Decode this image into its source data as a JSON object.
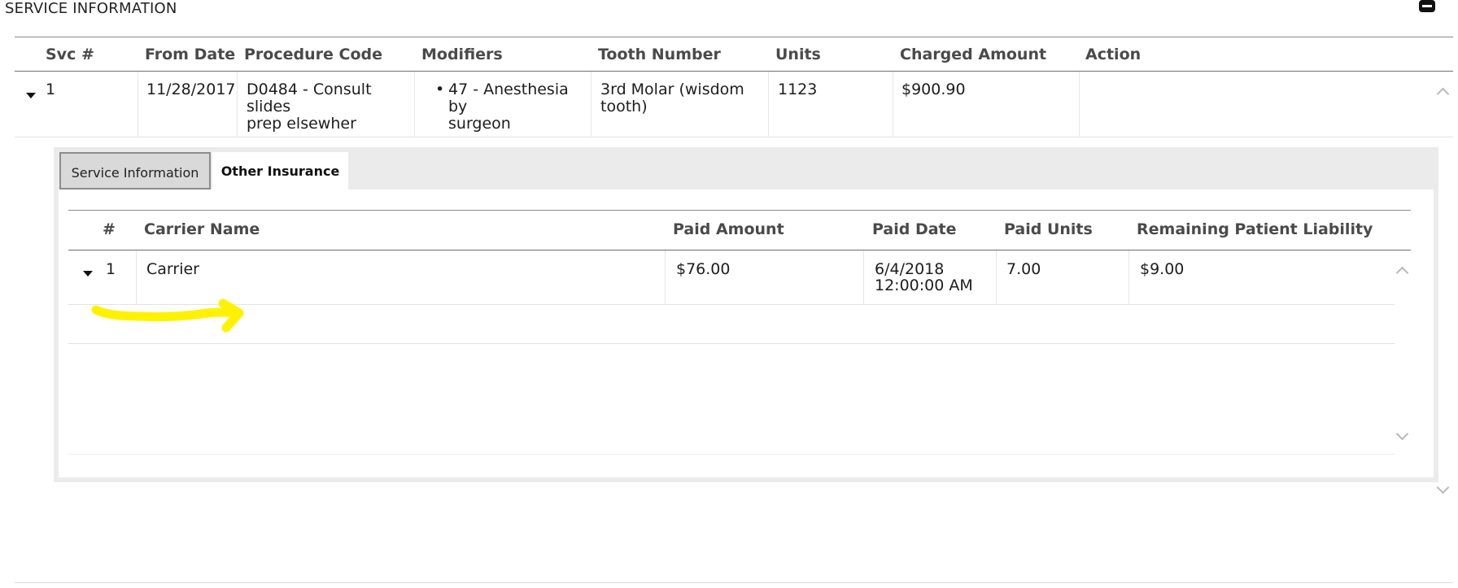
{
  "section": {
    "title": "SERVICE INFORMATION"
  },
  "table": {
    "headers": [
      "Svc #",
      "From Date",
      "Procedure Code",
      "Modifiers",
      "Tooth Number",
      "Units",
      "Charged Amount",
      "Action"
    ],
    "row": {
      "svc": "1",
      "from_date": "11/28/2017",
      "procedure_line1": "D0484 - Consult slides",
      "procedure_line2": "prep elsewher",
      "modifier_line1": "47 - Anesthesia by",
      "modifier_line2": "surgeon",
      "tooth_line1": "3rd Molar (wisdom",
      "tooth_line2": "tooth)",
      "units": "1123",
      "charged": "$900.90",
      "action": ""
    }
  },
  "tabs": [
    "Service Information",
    "Other Insurance"
  ],
  "other_insurance": {
    "headers": [
      "#",
      "Carrier Name",
      "Paid Amount",
      "Paid Date",
      "Paid Units",
      "Remaining Patient Liability"
    ],
    "row": {
      "num": "1",
      "carrier": "Carrier",
      "paid_amount": "$76.00",
      "paid_date_line1": "6/4/2018",
      "paid_date_line2": "12:00:00 AM",
      "paid_units": "7.00",
      "liability": "$9.00"
    }
  },
  "colors": {
    "annotation_arrow": "#fff200",
    "header_text": "#4a4a4a"
  }
}
